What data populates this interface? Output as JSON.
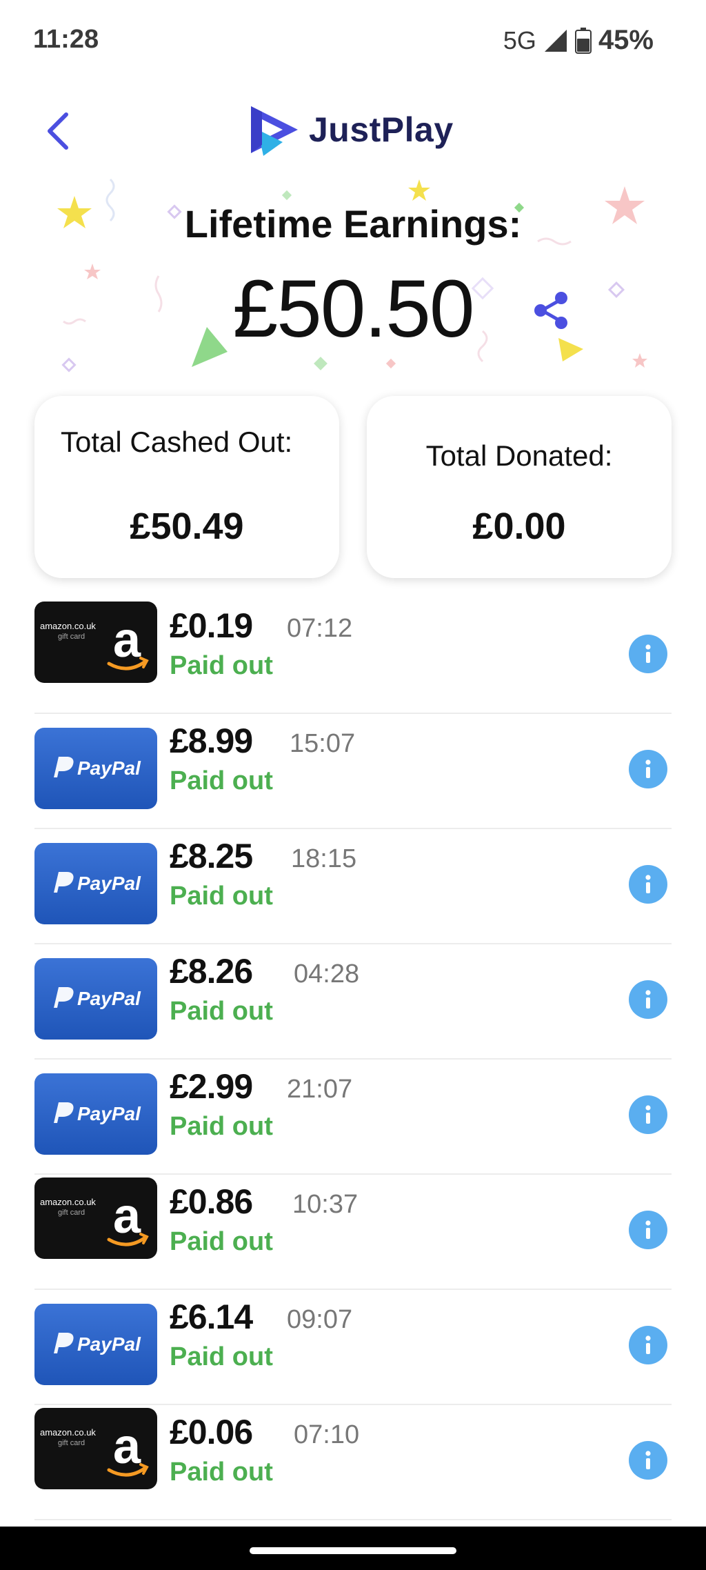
{
  "status_bar": {
    "time": "11:28",
    "network": "5G",
    "battery": "45%"
  },
  "header": {
    "back_icon": "chevron-left-icon",
    "app_name": "JustPlay",
    "logo_colors": [
      "#4b4fe0",
      "#2fb0e6"
    ]
  },
  "hero": {
    "title": "Lifetime Earnings:",
    "value": "£50.50",
    "share_icon": "share-icon",
    "accent": "#4b4fe0"
  },
  "summary": {
    "cashed_out_label": "Total Cashed Out:",
    "cashed_out_value": "£50.49",
    "donated_label": "Total Donated:",
    "donated_value": "£0.00"
  },
  "colors": {
    "paid_out": "#4caf50",
    "info": "#5aaef0"
  },
  "history": [
    {
      "provider": "amazon",
      "provider_text": "amazon.co.uk",
      "provider_sub": "gift card",
      "amount": "£0.19",
      "time": "07:12",
      "status": "Paid out"
    },
    {
      "provider": "paypal",
      "provider_text": "PayPal",
      "amount": "£8.99",
      "time": "15:07",
      "status": "Paid out"
    },
    {
      "provider": "paypal",
      "provider_text": "PayPal",
      "amount": "£8.25",
      "time": "18:15",
      "status": "Paid out"
    },
    {
      "provider": "paypal",
      "provider_text": "PayPal",
      "amount": "£8.26",
      "time": "04:28",
      "status": "Paid out"
    },
    {
      "provider": "paypal",
      "provider_text": "PayPal",
      "amount": "£2.99",
      "time": "21:07",
      "status": "Paid out"
    },
    {
      "provider": "amazon",
      "provider_text": "amazon.co.uk",
      "provider_sub": "gift card",
      "amount": "£0.86",
      "time": "10:37",
      "status": "Paid out"
    },
    {
      "provider": "paypal",
      "provider_text": "PayPal",
      "amount": "£6.14",
      "time": "09:07",
      "status": "Paid out"
    },
    {
      "provider": "amazon",
      "provider_text": "amazon.co.uk",
      "provider_sub": "gift card",
      "amount": "£0.06",
      "time": "07:10",
      "status": "Paid out"
    }
  ]
}
